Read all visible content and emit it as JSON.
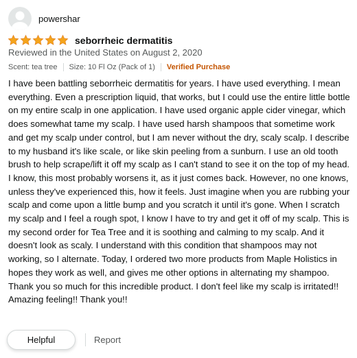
{
  "profile": {
    "username": "powershar",
    "avatar_icon": "default-user-icon"
  },
  "rating": {
    "stars": 5,
    "max_stars": 5,
    "star_color": "#f4a41c",
    "icon": "star-icon"
  },
  "review": {
    "title": "seborrheic dermatitis",
    "reviewed_in": "Reviewed in the United States on August 2, 2020",
    "scent": "Scent: tea tree",
    "size": "Size: 10 Fl Oz (Pack of 1)",
    "verified": "Verified Purchase",
    "verified_color": "#c45500",
    "body": "I have been battling seborrheic dermatitis for years. I have used everything. I mean everything. Even a prescription liquid, that works, but I could use the entire little bottle on my entire scalp in one application. I have used organic apple cider vinegar, which does somewhat tame my scalp. I have used harsh shampoos that sometime work and get my scalp under control, but I am never without the dry, scaly scalp. I describe to my husband it's like scale, or like skin peeling from a sunburn. I use an old tooth brush to help scrape/lift it off my scalp as I can't stand to see it on the top of my head. I know, this most probably worsens it, as it just comes back. However, no one knows, unless they've experienced this, how it feels. Just imagine when you are rubbing your scalp and come upon a little bump and you scratch it until it's gone. When I scratch my scalp and I feel a rough spot, I know I have to try and get it off of my scalp. This is my second order for Tea Tree and it is soothing and calming to my scalp. And it doesn't look as scaly. I understand with this condition that shampoos may not working, so I alternate. Today, I ordered two more products from Maple Holistics in hopes they work as well, and gives me other options in alternating my shampoo. Thank you so much for this incredible product. I don't feel like my scalp is irritated!! Amazing feeling!! Thank you!!"
  },
  "actions": {
    "helpful_label": "Helpful",
    "report_label": "Report"
  }
}
